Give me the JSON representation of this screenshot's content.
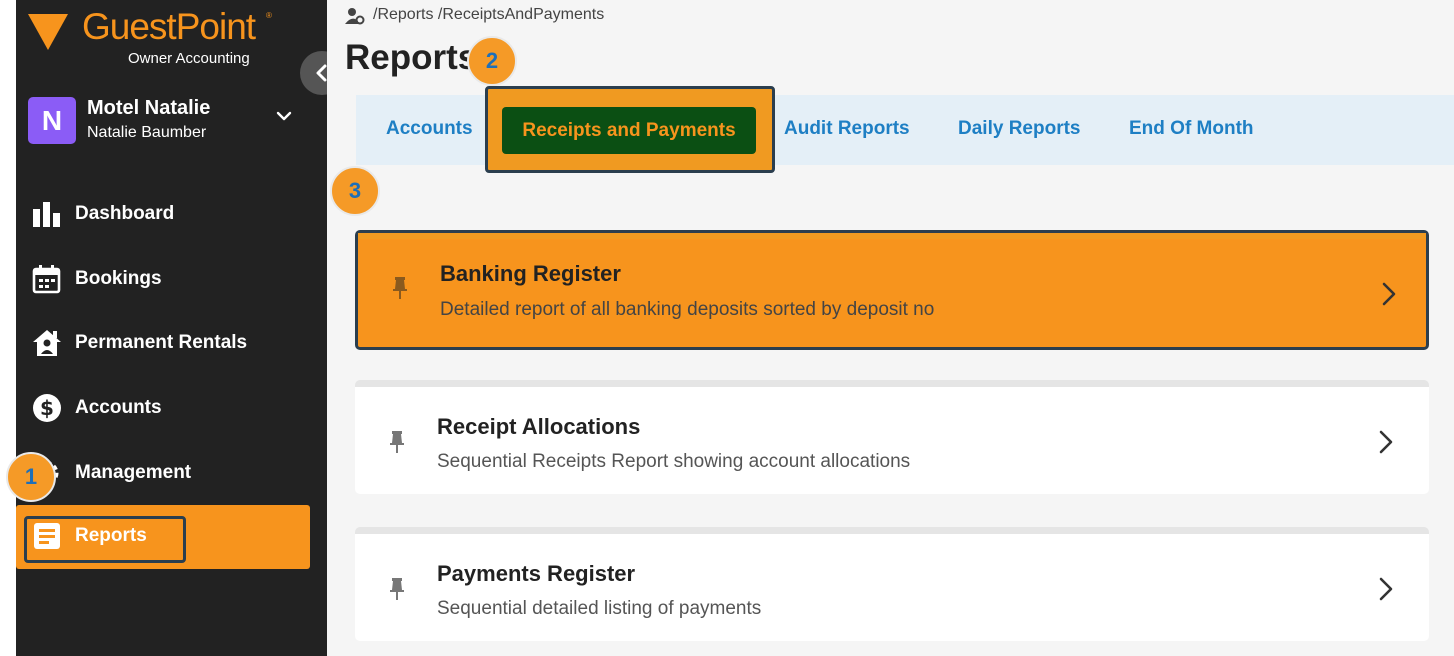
{
  "brand": {
    "name": "GuestPoint",
    "tm": "®",
    "subtitle": "Owner Accounting",
    "color": "#f7941d"
  },
  "property": {
    "initial": "N",
    "name": "Motel Natalie",
    "user": "Natalie Baumber",
    "avatar_color": "#8b5cf6"
  },
  "sidebar": {
    "items": [
      {
        "label": "Dashboard",
        "icon": "bar-chart-icon"
      },
      {
        "label": "Bookings",
        "icon": "calendar-icon"
      },
      {
        "label": "Permanent Rentals",
        "icon": "house-user-icon"
      },
      {
        "label": "Accounts",
        "icon": "dollar-circle-icon"
      },
      {
        "label": "Management",
        "icon": "gear-icon"
      },
      {
        "label": "Reports",
        "icon": "document-icon",
        "active": true
      }
    ]
  },
  "breadcrumb": {
    "text": "/Reports /ReceiptsAndPayments"
  },
  "page": {
    "title": "Reports"
  },
  "tabs": [
    {
      "label": "Accounts"
    },
    {
      "label": "Receipts and Payments",
      "active": true
    },
    {
      "label": "Audit Reports"
    },
    {
      "label": "Daily Reports"
    },
    {
      "label": "End Of Month"
    }
  ],
  "badges": [
    "1",
    "2",
    "3"
  ],
  "reports": [
    {
      "title": "Banking Register",
      "description": "Detailed report of all banking deposits sorted by deposit no",
      "highlighted": true
    },
    {
      "title": "Receipt Allocations",
      "description": "Sequential Receipts Report showing account allocations"
    },
    {
      "title": "Payments Register",
      "description": "Sequential detailed listing of payments"
    }
  ],
  "colors": {
    "sidebar_bg": "#222222",
    "accent": "#f7941d",
    "tab_link": "#1e7fc4",
    "active_tab_bg": "#0b4f13",
    "badge_text": "#1e6fb8"
  }
}
